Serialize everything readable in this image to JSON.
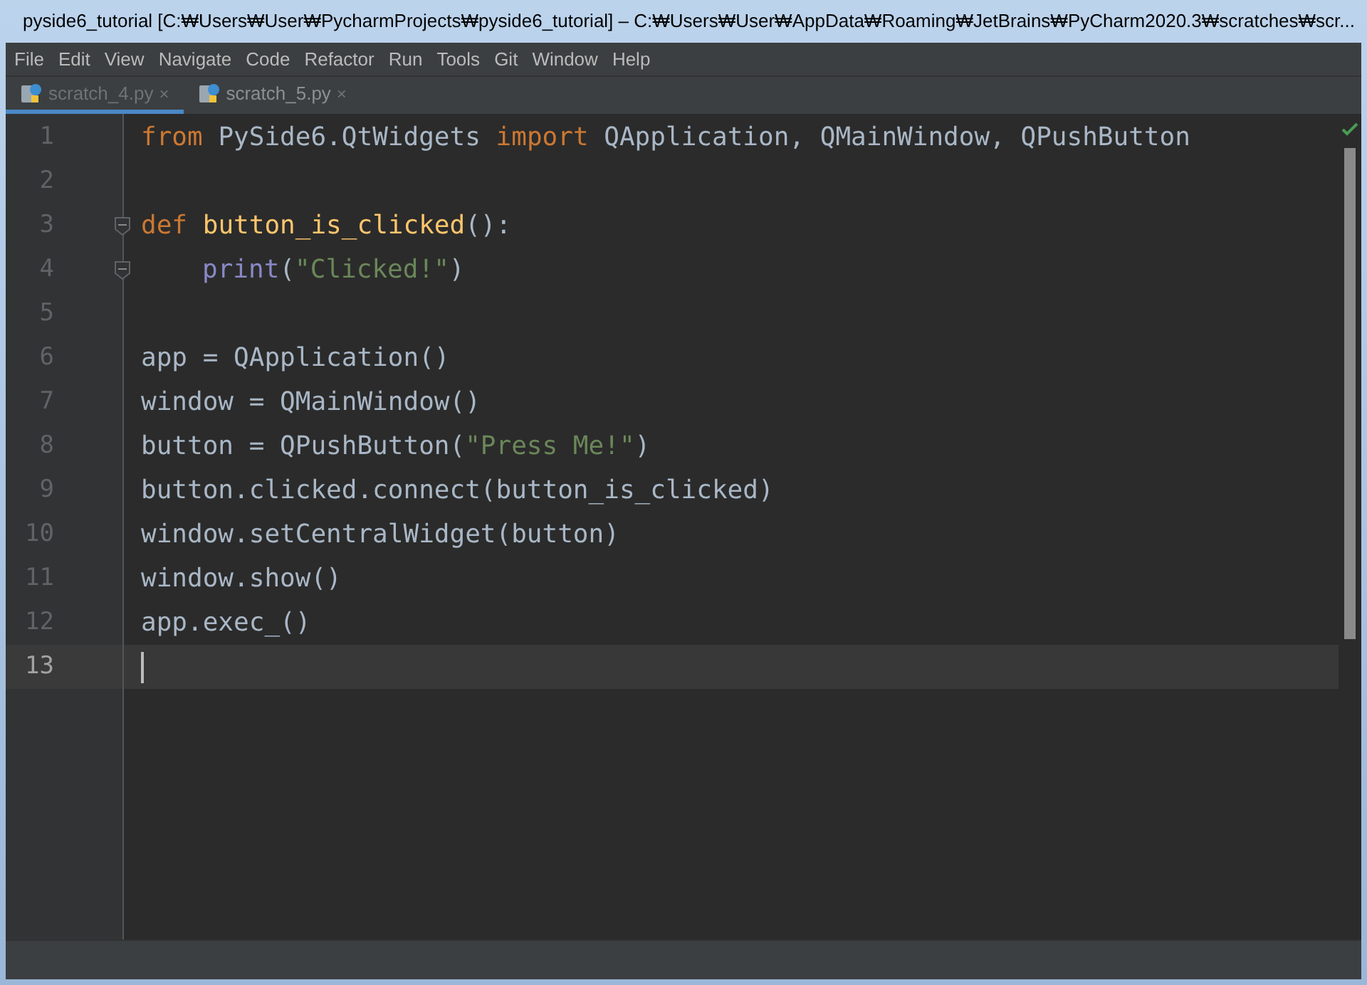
{
  "window": {
    "title": "pyside6_tutorial  [C:₩Users₩User₩PycharmProjects₩pyside6_tutorial] – C:₩Users₩User₩AppData₩Roaming₩JetBrains₩PyCharm2020.3₩scratches₩scr..."
  },
  "menu": [
    "File",
    "Edit",
    "View",
    "Navigate",
    "Code",
    "Refactor",
    "Run",
    "Tools",
    "Git",
    "Window",
    "Help"
  ],
  "tabs": [
    {
      "label": "scratch_4.py",
      "close": "×",
      "selected": true
    },
    {
      "label": "scratch_5.py",
      "close": "×",
      "selected": false
    }
  ],
  "editor": {
    "lines": [
      {
        "number": "1",
        "current": false,
        "fold": false,
        "tokens": [
          {
            "text": "from",
            "kind": "keyword"
          },
          {
            "text": " PySide6.QtWidgets ",
            "kind": "plain"
          },
          {
            "text": "import",
            "kind": "keyword"
          },
          {
            "text": " QApplication, QMainWindow, QPushButton",
            "kind": "plain"
          }
        ]
      },
      {
        "number": "2",
        "current": false,
        "fold": false
      },
      {
        "number": "3",
        "current": false,
        "fold": true,
        "tokens": [
          {
            "text": "def ",
            "kind": "keyword"
          },
          {
            "text": "button_is_clicked",
            "kind": "function"
          },
          {
            "text": "():",
            "kind": "plain"
          }
        ]
      },
      {
        "number": "4",
        "current": false,
        "fold": true,
        "indented": true,
        "tokens": [
          {
            "text": "print",
            "kind": "builtin"
          },
          {
            "text": "(",
            "kind": "plain"
          },
          {
            "text": "\"Clicked!\"",
            "kind": "string"
          },
          {
            "text": ")",
            "kind": "plain"
          }
        ]
      },
      {
        "number": "5",
        "current": false,
        "fold": false
      },
      {
        "number": "6",
        "current": false,
        "fold": false,
        "tokens": [
          {
            "text": "app = QApplication()",
            "kind": "plain"
          }
        ]
      },
      {
        "number": "7",
        "current": false,
        "fold": false,
        "tokens": [
          {
            "text": "window = QMainWindow()",
            "kind": "plain"
          }
        ]
      },
      {
        "number": "8",
        "current": false,
        "fold": false,
        "tokens": [
          {
            "text": "button = QPushButton(",
            "kind": "plain"
          },
          {
            "text": "\"Press Me!\"",
            "kind": "string"
          },
          {
            "text": ")",
            "kind": "plain"
          }
        ]
      },
      {
        "number": "9",
        "current": false,
        "fold": false,
        "tokens": [
          {
            "text": "button.clicked.connect(button_is_clicked)",
            "kind": "plain"
          }
        ]
      },
      {
        "number": "10",
        "current": false,
        "fold": false,
        "tokens": [
          {
            "text": "window.setCentralWidget(button)",
            "kind": "plain"
          }
        ]
      },
      {
        "number": "11",
        "current": false,
        "fold": false,
        "tokens": [
          {
            "text": "window.show()",
            "kind": "plain"
          }
        ]
      },
      {
        "number": "12",
        "current": false,
        "fold": false,
        "tokens": [
          {
            "text": "app.exec_()",
            "kind": "plain"
          }
        ]
      },
      {
        "number": "13",
        "current": true,
        "fold": false
      }
    ]
  }
}
